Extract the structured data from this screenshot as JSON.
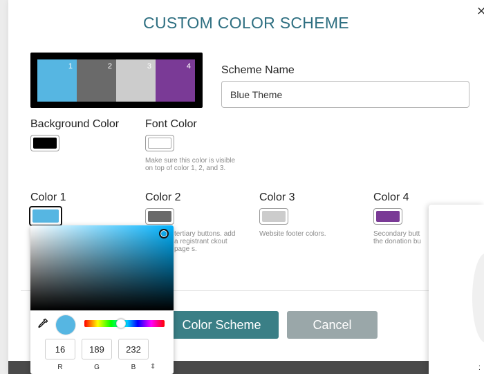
{
  "modal": {
    "title": "CUSTOM COLOR SCHEME",
    "close_glyph": "×"
  },
  "preview": {
    "background": "#000000",
    "segments": [
      {
        "label": "1",
        "color": "#56b6e2"
      },
      {
        "label": "2",
        "color": "#6a6a6a"
      },
      {
        "label": "3",
        "color": "#cccccc"
      },
      {
        "label": "4",
        "color": "#7a3a96"
      }
    ]
  },
  "scheme_name": {
    "label": "Scheme Name",
    "value": "Blue Theme"
  },
  "background_color": {
    "label": "Background Color",
    "value": "#000000"
  },
  "font_color": {
    "label": "Font Color",
    "value": "#ffffff",
    "hint": "Make sure this color is visible on top of color 1, 2, and 3."
  },
  "colors": [
    {
      "label": "Color 1",
      "value": "#56b6e2",
      "hint": ""
    },
    {
      "label": "Color 2",
      "value": "#6a6a6a",
      "hint": "tertiary buttons. add a registrant ckout page s."
    },
    {
      "label": "Color 3",
      "value": "#cccccc",
      "hint": "Website footer colors."
    },
    {
      "label": "Color 4",
      "value": "#7a3a96",
      "hint": "Secondary butt the donation bu"
    }
  ],
  "buttons": {
    "save_label": "Color Scheme",
    "cancel_label": "Cancel",
    "save_color": "#3a7f86",
    "cancel_color": "#9aa7a9"
  },
  "picker": {
    "current_color": "#56b6e2",
    "r": "16",
    "g": "189",
    "b": "232",
    "r_label": "R",
    "g_label": "G",
    "b_label": "B",
    "mode_toggle_glyph": "⇕",
    "eyedropper_icon": "eyedropper-icon"
  },
  "accent_color": "#2e6f81"
}
